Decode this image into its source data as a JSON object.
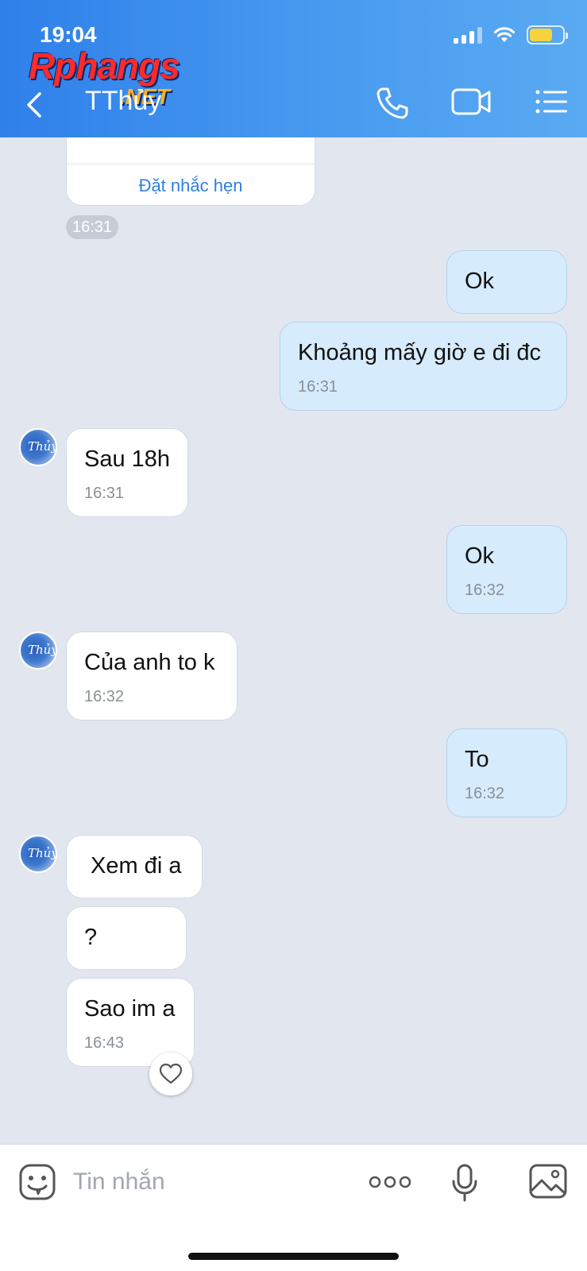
{
  "status_bar": {
    "time": "19:04"
  },
  "watermark": {
    "main": "Rphangs",
    "suffix": ".NET"
  },
  "header": {
    "title": "TThủy"
  },
  "reminder": {
    "button_label": "Đặt nhắc hẹn",
    "time": "16:31"
  },
  "messages": [
    {
      "direction": "out",
      "text": "Ok",
      "time": ""
    },
    {
      "direction": "out",
      "text": "Khoảng mấy giờ e đi đc",
      "time": "16:31"
    },
    {
      "direction": "in",
      "text": "Sau 18h",
      "time": "16:31"
    },
    {
      "direction": "out",
      "text": "Ok",
      "time": "16:32"
    },
    {
      "direction": "in",
      "text": "Của anh to k",
      "time": "16:32"
    },
    {
      "direction": "out",
      "text": "To",
      "time": "16:32"
    },
    {
      "direction": "in",
      "text": "Xem đi a",
      "time": ""
    },
    {
      "direction": "in",
      "text": "?",
      "time": ""
    },
    {
      "direction": "in",
      "text": "Sao im a",
      "time": "16:43"
    }
  ],
  "avatar": {
    "label": "Thủy"
  },
  "composer": {
    "placeholder": "Tin nhắn"
  },
  "colors": {
    "header": "#3d8eee",
    "outgoing_bubble": "#d6ebfb",
    "incoming_bubble": "#ffffff",
    "chat_bg": "#e2e6ee",
    "link": "#2f7fe0"
  }
}
